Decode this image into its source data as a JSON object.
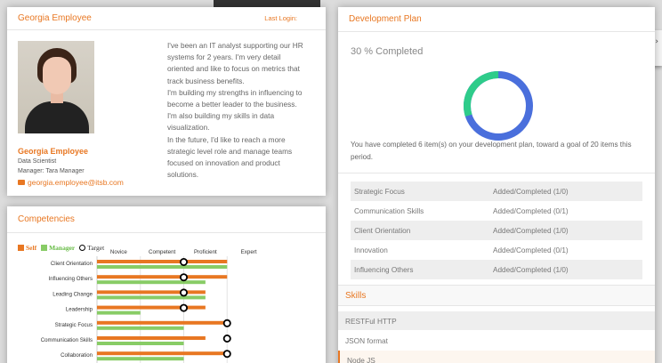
{
  "profile": {
    "header_name": "Georgia Employee",
    "last_login_label": "Last Login:",
    "name": "Georgia Employee",
    "title": "Data Scientist",
    "manager": "Manager: Tara Manager",
    "email": "georgia.employee@itsb.com",
    "bio_lines": [
      "I've been an IT analyst supporting our HR",
      "systems for 2 years. I'm very detail",
      "oriented and like to focus on metrics that",
      "track business benefits.",
      "I'm building my strengths in influencing to",
      "become a better leader to the business.",
      "I'm also building my skills in data",
      "visualization.",
      "In the future, I'd like to reach a more",
      "strategic level role and manage teams",
      "focused on innovation and product",
      "solutions."
    ]
  },
  "competencies": {
    "title": "Competencies",
    "legend": {
      "self": "Self",
      "manager": "Manager",
      "target": "Target"
    },
    "colors": {
      "self": "#e87722",
      "manager": "#88cc66",
      "target": "#000000"
    }
  },
  "chart_data": {
    "type": "bar",
    "levels": [
      "Novice",
      "Competent",
      "Proficient",
      "Expert"
    ],
    "categories": [
      "Client Orientation",
      "Influencing Others",
      "Leading Change",
      "Leadership",
      "Strategic Focus",
      "Communication Skills",
      "Collaboration"
    ],
    "series": [
      {
        "name": "Self",
        "values": [
          3.0,
          3.0,
          2.5,
          2.5,
          3.0,
          2.5,
          3.0
        ]
      },
      {
        "name": "Manager",
        "values": [
          3.0,
          2.5,
          2.5,
          1.0,
          2.0,
          2.0,
          2.0
        ]
      },
      {
        "name": "Target",
        "values": [
          2.0,
          2.0,
          2.0,
          2.0,
          3.0,
          3.0,
          3.0
        ]
      }
    ],
    "xlim": [
      0,
      4
    ]
  },
  "dev_plan": {
    "title": "Development Plan",
    "percent_text": "30 % Completed",
    "completed_fraction": 0.3,
    "colors": {
      "completed": "#2ecc8a",
      "remaining": "#4a6fdc"
    },
    "message": "You have completed 6 item(s) on your development plan, toward a goal of 20 items this period.",
    "rows": [
      {
        "name": "Strategic Focus",
        "status": "Added/Completed (1/0)"
      },
      {
        "name": "Communication Skills",
        "status": "Added/Completed (0/1)"
      },
      {
        "name": "Client Orientation",
        "status": "Added/Completed (1/0)"
      },
      {
        "name": "Innovation",
        "status": "Added/Completed (0/1)"
      },
      {
        "name": "Influencing Others",
        "status": "Added/Completed (1/0)"
      }
    ]
  },
  "skills": {
    "title": "Skills",
    "items": [
      "RESTFul HTTP",
      "JSON format",
      "Node JS"
    ]
  }
}
